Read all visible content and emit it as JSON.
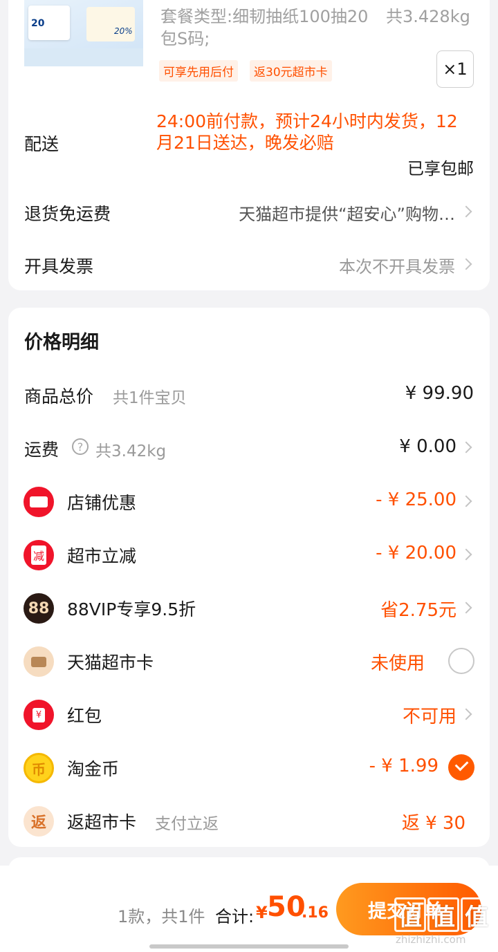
{
  "product": {
    "desc_line1": "套餐类型:细韧抽纸100抽20",
    "weight": "共3.428kg",
    "desc_line2": "包S码;",
    "tags": [
      "可享先用后付",
      "返30元超市卡"
    ],
    "qty": "×1",
    "image_text_a": "20",
    "image_text_b": "20%"
  },
  "delivery": {
    "label": "配送",
    "promise_line1": "24:00前付款，预计24小时内发货，12",
    "promise_line2": "月21日送达，晚发必赔",
    "free_shipping": "已享包邮"
  },
  "return_row": {
    "label": "退货免运费",
    "value": "天猫超市提供“超安心”购物…"
  },
  "invoice_row": {
    "label": "开具发票",
    "value": "本次不开具发票"
  },
  "price_detail": {
    "title": "价格明细",
    "total": {
      "label": "商品总价",
      "sub": "共1件宝贝",
      "value": "¥ 99.90"
    },
    "shipping": {
      "label": "运费",
      "help": "?",
      "sub": "共3.42kg",
      "value": "¥ 0.00"
    },
    "items": [
      {
        "label": "店铺优惠",
        "value": "- ¥ 25.00",
        "icon": "ticket-icon"
      },
      {
        "label": "超市立减",
        "value": "- ¥ 20.00",
        "icon": "reduce-icon",
        "icon_text": "减"
      },
      {
        "label": "88VIP专享9.5折",
        "value": "省2.75元",
        "icon": "vip88-icon",
        "icon_text": "88"
      },
      {
        "label": "天猫超市卡",
        "value": "未使用",
        "icon": "card-icon"
      },
      {
        "label": "红包",
        "value": "不可用",
        "icon": "red-packet-icon",
        "icon_text": "¥"
      },
      {
        "label": "淘金币",
        "value": "- ¥ 1.99",
        "icon": "coin-icon",
        "icon_text": "币"
      },
      {
        "label": "返超市卡",
        "sub": "支付立返",
        "value": "返 ¥ 30",
        "icon": "rebate-icon",
        "icon_text": "返"
      }
    ]
  },
  "footer": {
    "count": "1款，共1件",
    "total_label": "合计:",
    "currency": "¥",
    "total_int": "50",
    "total_dec": ".16",
    "submit": "提交订单"
  },
  "watermark": {
    "chars": [
      "值",
      "值",
      "值"
    ],
    "domain": "zhizhizhi.com"
  },
  "colors": {
    "accent": "#ff5000",
    "background": "#f3f3f5"
  }
}
